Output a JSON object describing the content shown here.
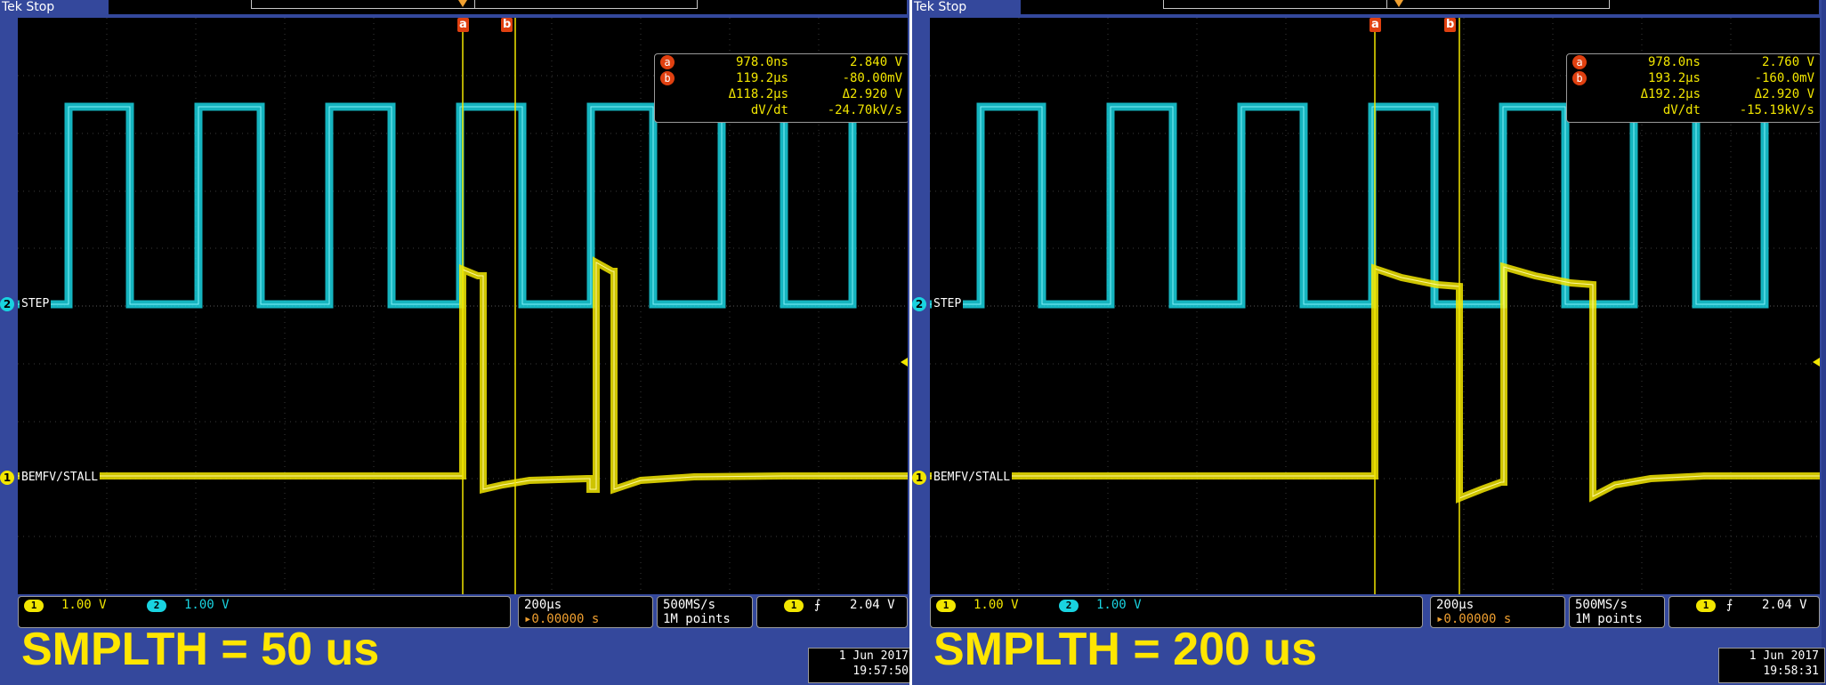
{
  "screens": [
    {
      "status": "Tek Stop",
      "cursor_a_label": "a",
      "cursor_b_label": "b",
      "readout": {
        "a_time": "978.0ns",
        "a_value": "2.840 V",
        "b_time": "119.2µs",
        "b_value": "-80.00mV",
        "delta_time": "Δ118.2µs",
        "delta_value": "Δ2.920 V",
        "dvdt_label": "dV/dt",
        "dvdt_value": "-24.70kV/s"
      },
      "ch1_name": "BEMFV/STALL",
      "ch2_name": "STEP",
      "ch1_scale": "1.00 V",
      "ch2_scale": "1.00 V",
      "timebase": "200µs",
      "trigger_pos": "▸0.00000 s",
      "sample_rate": "500MS/s",
      "record_length": "1M points",
      "trigger_level": "2.04 V",
      "caption": "SMPLTH = 50 us",
      "date": "1 Jun 2017",
      "time": "19:57:50"
    },
    {
      "status": "Tek Stop",
      "cursor_a_label": "a",
      "cursor_b_label": "b",
      "readout": {
        "a_time": "978.0ns",
        "a_value": "2.760 V",
        "b_time": "193.2µs",
        "b_value": "-160.0mV",
        "delta_time": "Δ192.2µs",
        "delta_value": "Δ2.920 V",
        "dvdt_label": "dV/dt",
        "dvdt_value": "-15.19kV/s"
      },
      "ch1_name": "BEMFV/STALL",
      "ch2_name": "STEP",
      "ch1_scale": "1.00 V",
      "ch2_scale": "1.00 V",
      "timebase": "200µs",
      "trigger_pos": "▸0.00000 s",
      "sample_rate": "500MS/s",
      "record_length": "1M points",
      "trigger_level": "2.04 V",
      "caption": "SMPLTH = 200 us",
      "date": "1 Jun 2017",
      "time": "19:58:31"
    }
  ],
  "channel_numbers": {
    "ch1": "1",
    "ch2": "2"
  },
  "colors": {
    "ch1": "#f2e600",
    "ch2": "#19d3e0",
    "cursor": "#e04010",
    "background": "#34489c"
  },
  "icons": {
    "trigger_slope": "rising-edge-icon"
  }
}
